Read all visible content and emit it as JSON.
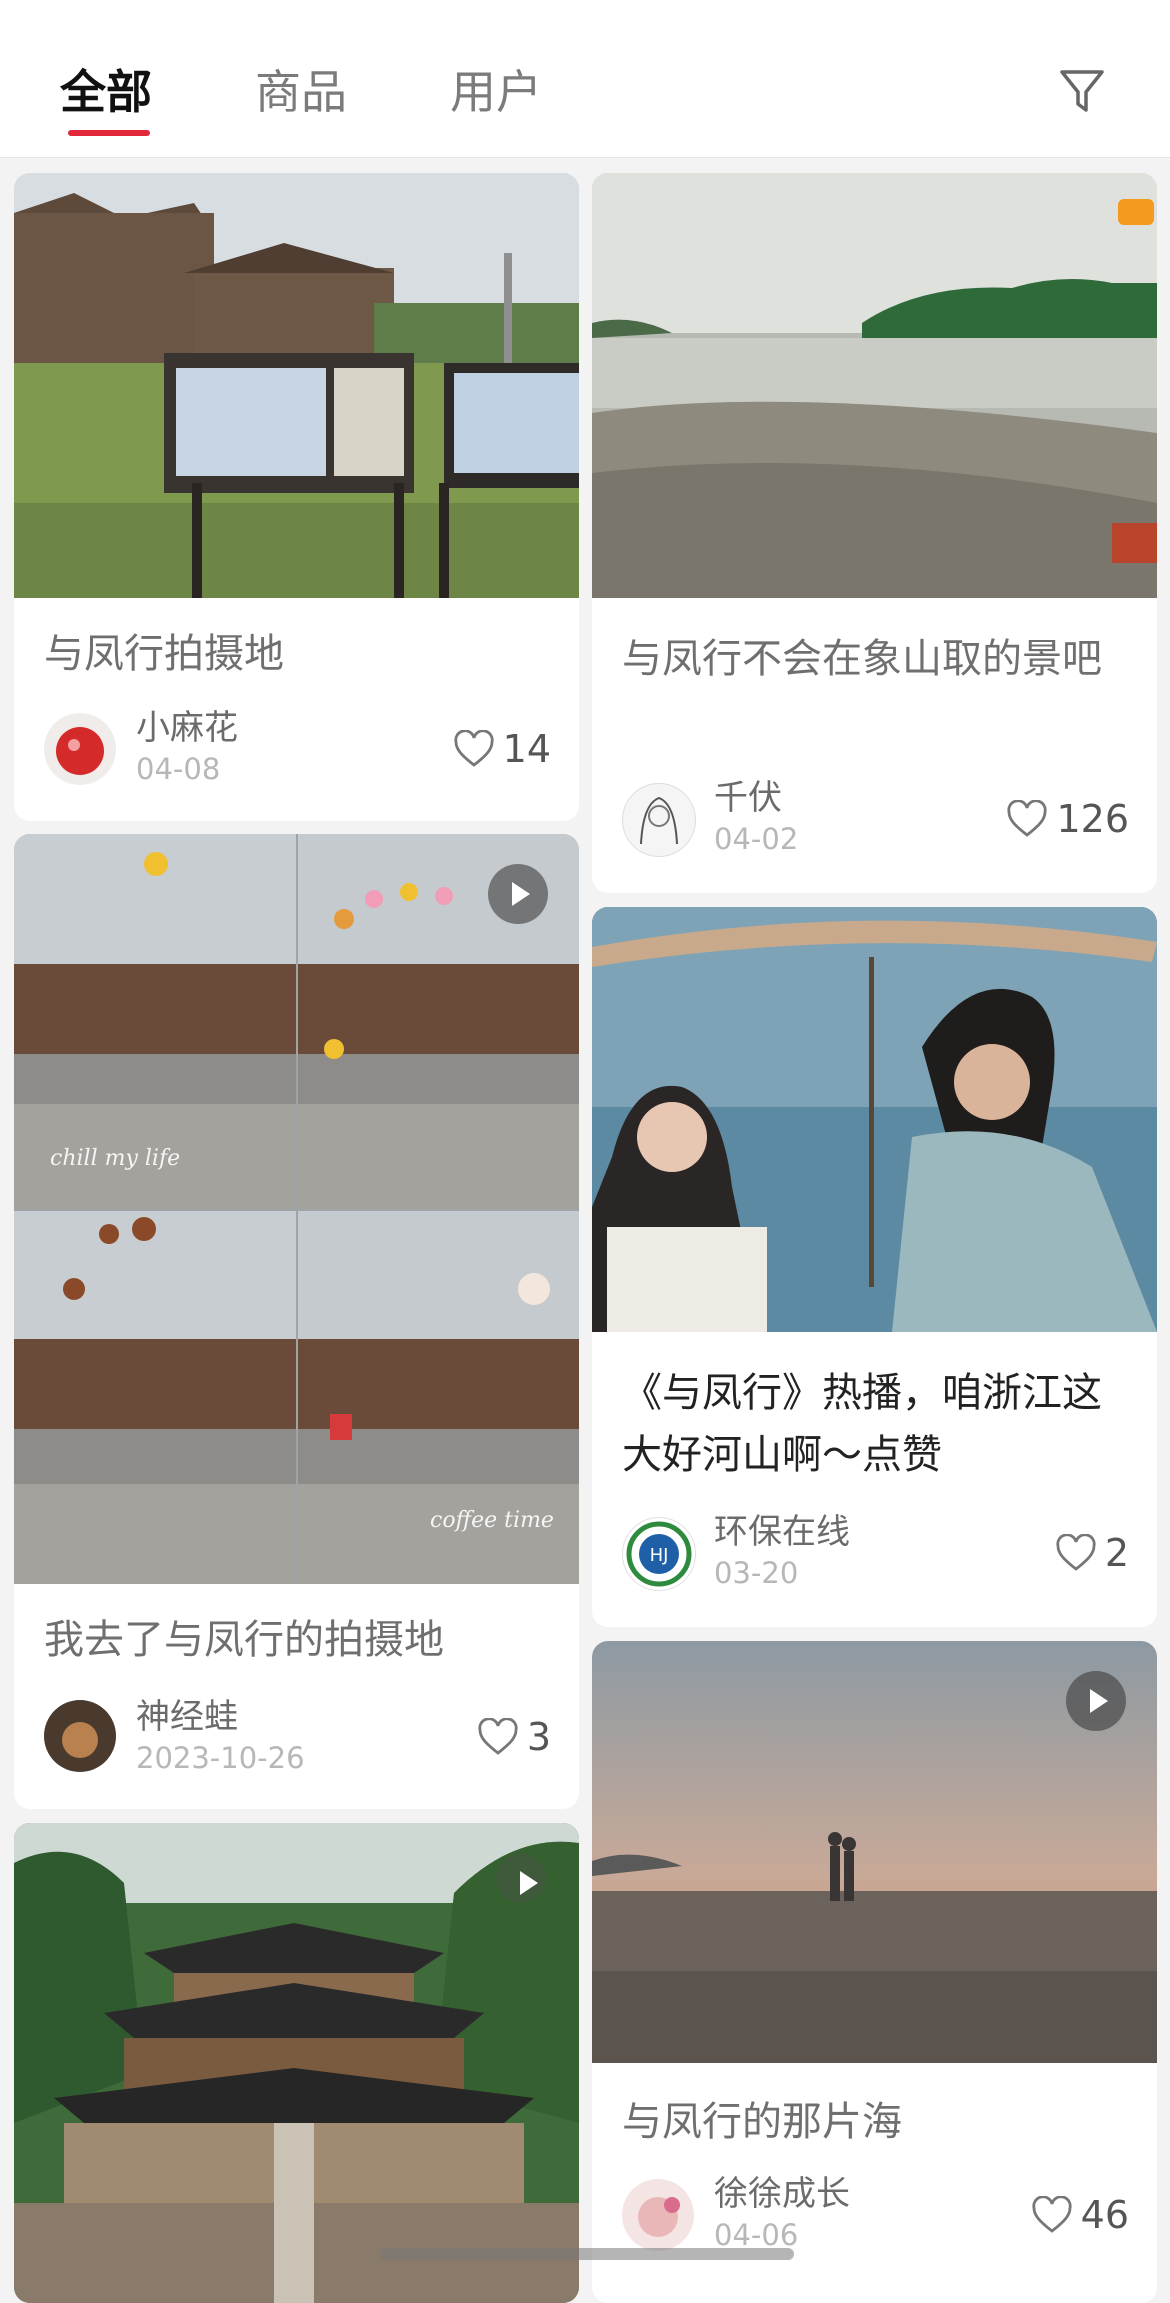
{
  "tabs": [
    "全部",
    "商品",
    "用户"
  ],
  "active_tab": "全部",
  "icons": {
    "filter": "filter-icon",
    "like": "heart-outline-icon",
    "play": "play-icon"
  },
  "colors": {
    "accent": "#e0283a"
  },
  "posts": [
    {
      "title": "与凤行拍摄地",
      "author": "小麻花",
      "date": "04-08",
      "likes": "14"
    },
    {
      "title": "与凤行不会在象山取的景吧",
      "author": "千伏",
      "date": "04-02",
      "likes": "126"
    },
    {
      "title": "我去了与凤行的拍摄地",
      "author": "神经蛙",
      "date": "2023-10-26",
      "likes": "3",
      "overlay_texts": [
        "chill my life",
        "coffee time"
      ]
    },
    {
      "title": "《与凤行》热播，咱浙江这大好河山啊～点赞",
      "author": "环保在线",
      "date": "03-20",
      "likes": "2"
    },
    {
      "title": "与凤行的那片海",
      "author": "徐徐成长",
      "date": "04-06",
      "likes": "46"
    }
  ]
}
